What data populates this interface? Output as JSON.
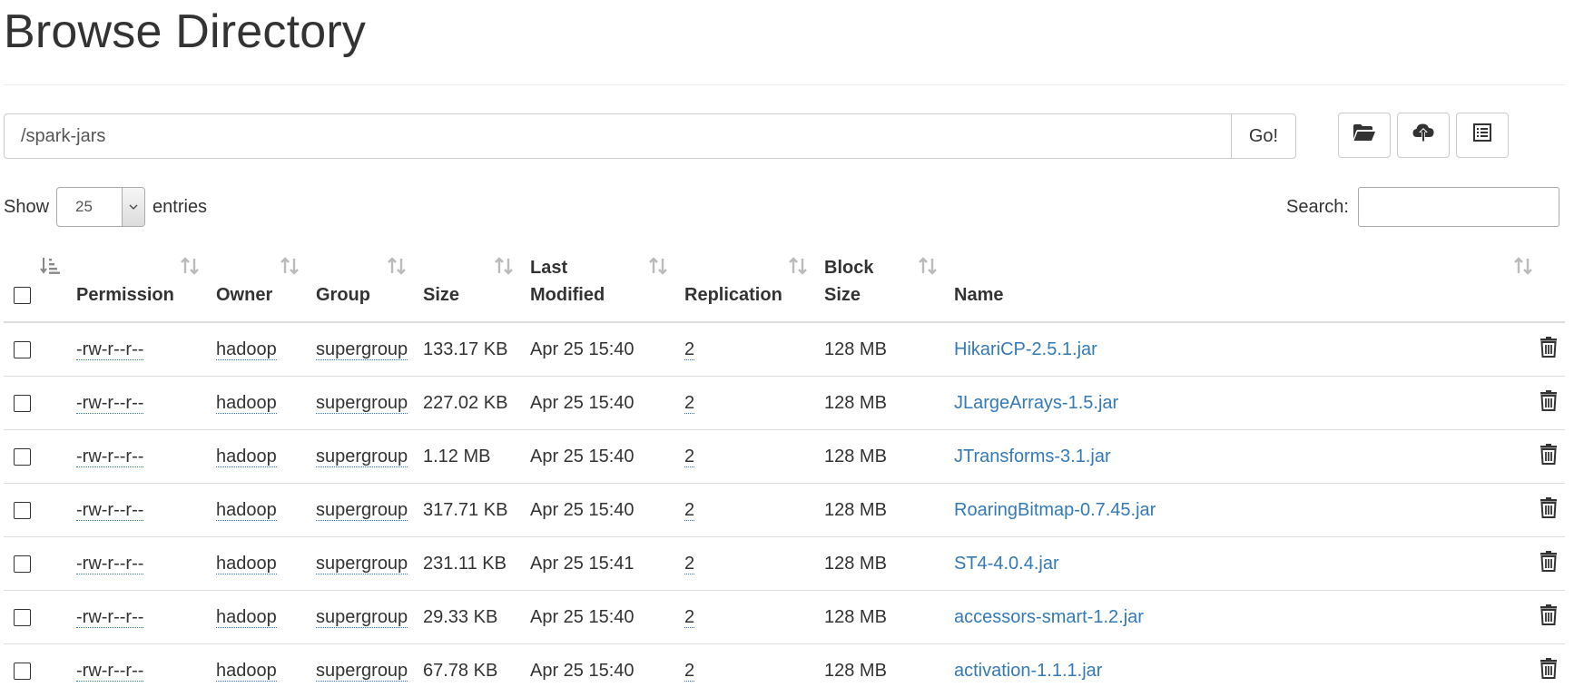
{
  "page_title": "Browse Directory",
  "path_input_value": "/spark-jars",
  "go_button": "Go!",
  "toolbar_icons": [
    "open-folder-icon",
    "cloud-upload-icon",
    "list-icon"
  ],
  "length_control": {
    "show_label": "Show",
    "selected": "25",
    "entries_label": "entries"
  },
  "search": {
    "label": "Search:",
    "value": ""
  },
  "table": {
    "headers": {
      "permission": "Permission",
      "owner": "Owner",
      "group": "Group",
      "size": "Size",
      "last_modified": "Last Modified",
      "replication": "Replication",
      "block_size": "Block Size",
      "name": "Name"
    },
    "rows": [
      {
        "permission": "-rw-r--r--",
        "owner": "hadoop",
        "group": "supergroup",
        "size": "133.17 KB",
        "last_modified": "Apr 25 15:40",
        "replication": "2",
        "block_size": "128 MB",
        "name": "HikariCP-2.5.1.jar"
      },
      {
        "permission": "-rw-r--r--",
        "owner": "hadoop",
        "group": "supergroup",
        "size": "227.02 KB",
        "last_modified": "Apr 25 15:40",
        "replication": "2",
        "block_size": "128 MB",
        "name": "JLargeArrays-1.5.jar"
      },
      {
        "permission": "-rw-r--r--",
        "owner": "hadoop",
        "group": "supergroup",
        "size": "1.12 MB",
        "last_modified": "Apr 25 15:40",
        "replication": "2",
        "block_size": "128 MB",
        "name": "JTransforms-3.1.jar"
      },
      {
        "permission": "-rw-r--r--",
        "owner": "hadoop",
        "group": "supergroup",
        "size": "317.71 KB",
        "last_modified": "Apr 25 15:40",
        "replication": "2",
        "block_size": "128 MB",
        "name": "RoaringBitmap-0.7.45.jar"
      },
      {
        "permission": "-rw-r--r--",
        "owner": "hadoop",
        "group": "supergroup",
        "size": "231.11 KB",
        "last_modified": "Apr 25 15:41",
        "replication": "2",
        "block_size": "128 MB",
        "name": "ST4-4.0.4.jar"
      },
      {
        "permission": "-rw-r--r--",
        "owner": "hadoop",
        "group": "supergroup",
        "size": "29.33 KB",
        "last_modified": "Apr 25 15:40",
        "replication": "2",
        "block_size": "128 MB",
        "name": "accessors-smart-1.2.jar"
      },
      {
        "permission": "-rw-r--r--",
        "owner": "hadoop",
        "group": "supergroup",
        "size": "67.78 KB",
        "last_modified": "Apr 25 15:40",
        "replication": "2",
        "block_size": "128 MB",
        "name": "activation-1.1.1.jar"
      }
    ]
  },
  "colors": {
    "link": "#337ab7",
    "border": "#dddddd",
    "text": "#333333"
  }
}
